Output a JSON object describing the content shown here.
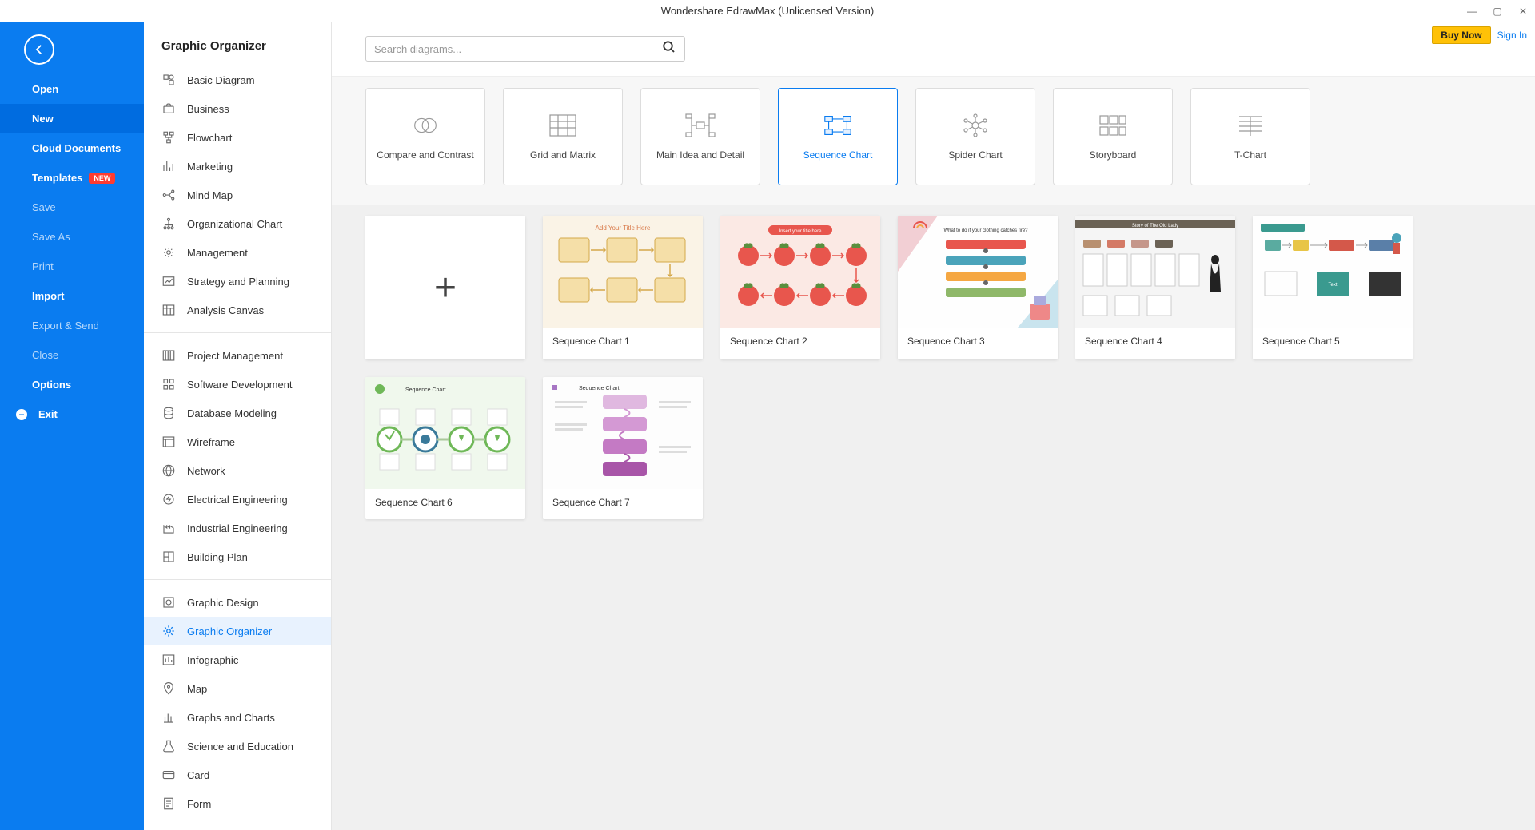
{
  "app": {
    "title": "Wondershare EdrawMax (Unlicensed Version)"
  },
  "header": {
    "buy_now": "Buy Now",
    "sign_in": "Sign In"
  },
  "sidebar": {
    "items": [
      {
        "label": "Open",
        "variant": "strong"
      },
      {
        "label": "New",
        "variant": "strong selected"
      },
      {
        "label": "Cloud Documents",
        "variant": "strong"
      },
      {
        "label": "Templates",
        "variant": "strong",
        "badge": "NEW"
      },
      {
        "label": "Save",
        "variant": "faded"
      },
      {
        "label": "Save As",
        "variant": "faded"
      },
      {
        "label": "Print",
        "variant": "faded"
      },
      {
        "label": "Import",
        "variant": "strong"
      },
      {
        "label": "Export & Send",
        "variant": "faded"
      },
      {
        "label": "Close",
        "variant": "faded"
      },
      {
        "label": "Options",
        "variant": "strong"
      },
      {
        "label": "Exit",
        "variant": "strong",
        "icon": "exit"
      }
    ]
  },
  "categories": {
    "title": "Graphic Organizer",
    "groups": [
      [
        {
          "label": "Basic Diagram",
          "icon": "basic"
        },
        {
          "label": "Business",
          "icon": "business"
        },
        {
          "label": "Flowchart",
          "icon": "flowchart"
        },
        {
          "label": "Marketing",
          "icon": "marketing"
        },
        {
          "label": "Mind Map",
          "icon": "mindmap"
        },
        {
          "label": "Organizational Chart",
          "icon": "org"
        },
        {
          "label": "Management",
          "icon": "mgmt"
        },
        {
          "label": "Strategy and Planning",
          "icon": "strategy"
        },
        {
          "label": "Analysis Canvas",
          "icon": "canvas"
        }
      ],
      [
        {
          "label": "Project Management",
          "icon": "project"
        },
        {
          "label": "Software Development",
          "icon": "software"
        },
        {
          "label": "Database Modeling",
          "icon": "db"
        },
        {
          "label": "Wireframe",
          "icon": "wire"
        },
        {
          "label": "Network",
          "icon": "network"
        },
        {
          "label": "Electrical Engineering",
          "icon": "elec"
        },
        {
          "label": "Industrial Engineering",
          "icon": "ind"
        },
        {
          "label": "Building Plan",
          "icon": "building"
        }
      ],
      [
        {
          "label": "Graphic Design",
          "icon": "design"
        },
        {
          "label": "Graphic Organizer",
          "icon": "organizer",
          "selected": true
        },
        {
          "label": "Infographic",
          "icon": "info"
        },
        {
          "label": "Map",
          "icon": "map"
        },
        {
          "label": "Graphs and Charts",
          "icon": "graphs"
        },
        {
          "label": "Science and Education",
          "icon": "science"
        },
        {
          "label": "Card",
          "icon": "card"
        },
        {
          "label": "Form",
          "icon": "form"
        }
      ]
    ]
  },
  "search": {
    "placeholder": "Search diagrams..."
  },
  "chart_types": [
    {
      "label": "Compare and Contrast",
      "icon": "compare"
    },
    {
      "label": "Grid and Matrix",
      "icon": "grid"
    },
    {
      "label": "Main Idea and Detail",
      "icon": "main"
    },
    {
      "label": "Sequence Chart",
      "icon": "sequence",
      "selected": true
    },
    {
      "label": "Spider Chart",
      "icon": "spider"
    },
    {
      "label": "Storyboard",
      "icon": "story"
    },
    {
      "label": "T-Chart",
      "icon": "tchart"
    }
  ],
  "templates": [
    {
      "label": "",
      "blank": true
    },
    {
      "label": "Sequence Chart 1",
      "bg": "#faf3e6"
    },
    {
      "label": "Sequence Chart 2",
      "bg": "#fbe9e4"
    },
    {
      "label": "Sequence Chart 3",
      "bg": "#fefefe"
    },
    {
      "label": "Sequence Chart 4",
      "bg": "#f5f5f5"
    },
    {
      "label": "Sequence Chart 5",
      "bg": "#fefefe"
    },
    {
      "label": "Sequence Chart 6",
      "bg": "#f0f8ed"
    },
    {
      "label": "Sequence Chart 7",
      "bg": "#fdfdfd"
    }
  ]
}
